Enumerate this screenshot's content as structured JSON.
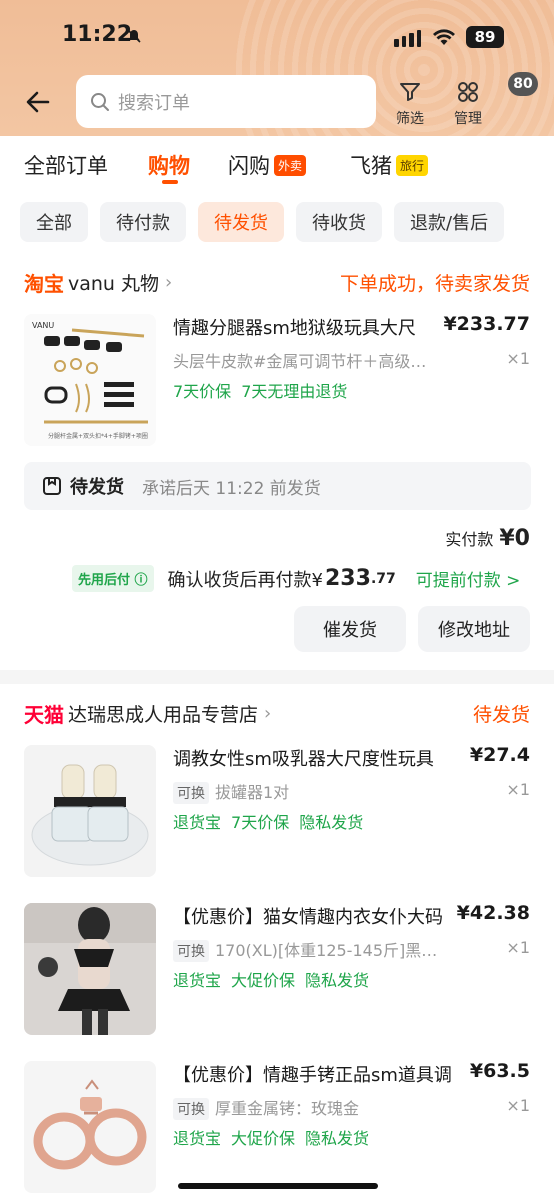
{
  "status_bar": {
    "time": "11:22",
    "battery": "89"
  },
  "header": {
    "search_placeholder": "搜索订单",
    "filter_label": "筛选",
    "manage_label": "管理",
    "message_count": "80"
  },
  "tabs": [
    {
      "label": "全部订单"
    },
    {
      "label": "购物",
      "active": true
    },
    {
      "label": "闪购",
      "badge": "外卖"
    },
    {
      "label": "飞猪",
      "badge": "旅行"
    }
  ],
  "filters": [
    "全部",
    "待付款",
    "待发货",
    "待收货",
    "退款/售后"
  ],
  "orders": [
    {
      "platform": "淘宝",
      "shop": "vanu 丸物",
      "status": "下单成功，待卖家发货",
      "items": [
        {
          "title": "情趣分腿器sm地狱级玩具大尺",
          "price": "¥233.77",
          "sku": "头层牛皮款#金属可调节杆＋高级…",
          "qty": "×1",
          "services": [
            "7天价保",
            "7天无理由退货"
          ],
          "thumb_brand": "VANU",
          "thumb_caption": "分腿杆金属+双头扣*4+手脚铐+项圈"
        }
      ],
      "ship_label": "待发货",
      "ship_note": "承诺后天 11:22 前发货",
      "paid_label": "实付款",
      "paid_amount": "¥0",
      "later_tag": "先用后付",
      "later_text": "确认收货后再付款¥",
      "later_amount": "233",
      "later_decimal": ".77",
      "later_link": "可提前付款 >",
      "buttons": [
        "催发货",
        "修改地址"
      ]
    },
    {
      "platform": "天猫",
      "shop": "达瑞思成人用品专营店",
      "status": "待发货",
      "items": [
        {
          "title": "调教女性sm吸乳器大尺度性玩具",
          "price": "¥27.4",
          "sku_tag": "可换",
          "sku": "拔罐器1对",
          "qty": "×1",
          "services": [
            "退货宝",
            "7天价保",
            "隐私发货"
          ]
        },
        {
          "title": "【优惠价】猫女情趣内衣女仆大码",
          "price": "¥42.38",
          "sku_tag": "可换",
          "sku": "170(XL)[体重125-145斤]黑…",
          "qty": "×1",
          "services": [
            "退货宝",
            "大促价保",
            "隐私发货"
          ]
        },
        {
          "title": "【优惠价】情趣手铐正品sm道具调",
          "price": "¥63.5",
          "sku_tag": "可换",
          "sku": "厚重金属铐：玫瑰金",
          "qty": "×1",
          "services": [
            "退货宝",
            "大促价保",
            "隐私发货"
          ]
        }
      ]
    }
  ],
  "colors": {
    "accent": "#ff5000",
    "service_green": "#1fa54a",
    "header_bg": "#f0bd97",
    "tmall_red": "#ff0036"
  }
}
